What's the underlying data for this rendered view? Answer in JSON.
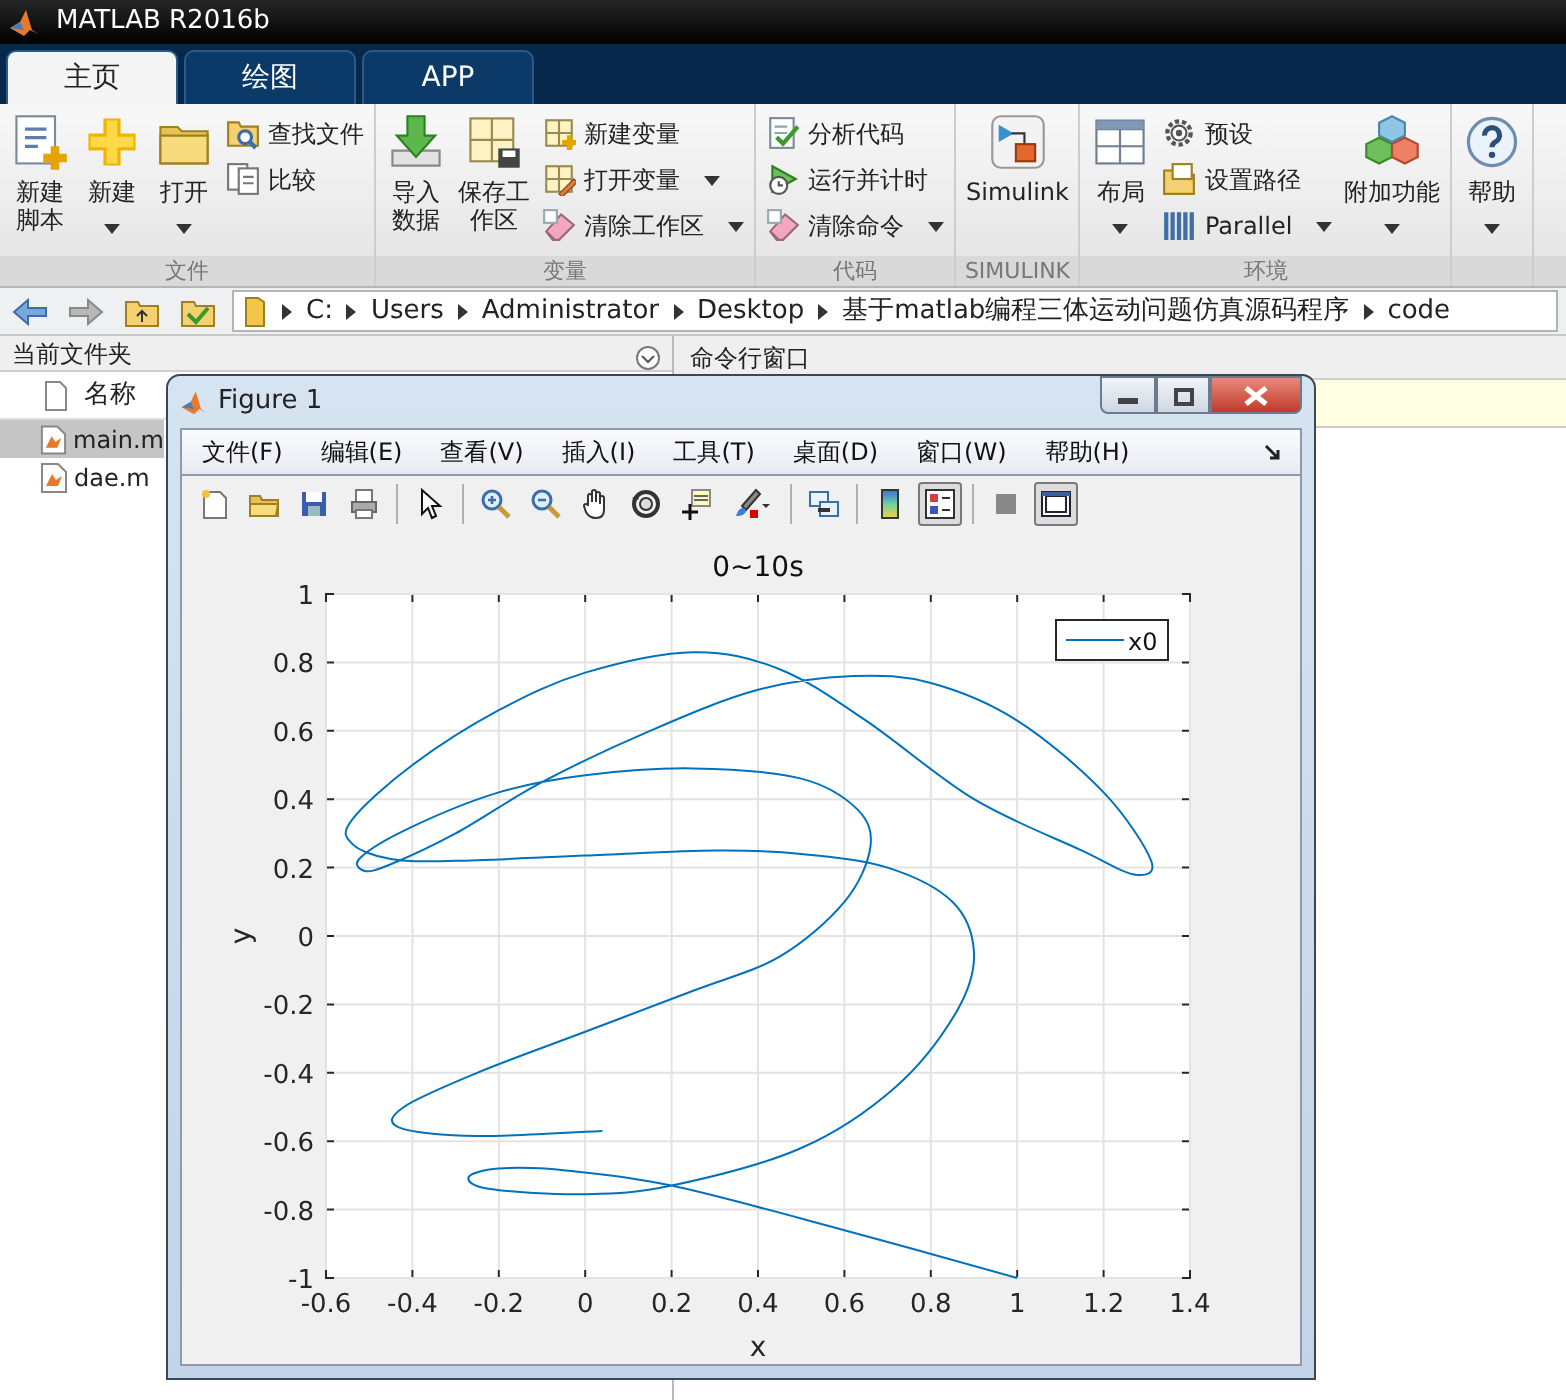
{
  "app_window": {
    "title": "MATLAB R2016b"
  },
  "tabs": [
    {
      "label": "主页",
      "selected": true
    },
    {
      "label": "绘图",
      "selected": false
    },
    {
      "label": "APP",
      "selected": false
    }
  ],
  "ribbon": [
    {
      "label": "文件",
      "columns": [
        {
          "kind": "large",
          "label": "新建脚本",
          "wrapped": true,
          "dropdown": false
        },
        {
          "kind": "large",
          "label": "新建",
          "dropdown": true
        },
        {
          "kind": "large",
          "label": "打开",
          "dropdown": true
        },
        {
          "kind": "stack",
          "items": [
            {
              "label": "查找文件",
              "dropdown": false
            },
            {
              "label": "比较",
              "dropdown": false
            }
          ]
        }
      ]
    },
    {
      "label": "变量",
      "columns": [
        {
          "kind": "large",
          "label": "导入数据",
          "wrapped": true,
          "dropdown": false
        },
        {
          "kind": "large",
          "label": "保存工作区",
          "wrapped": true,
          "dropdown": false
        },
        {
          "kind": "stack",
          "items": [
            {
              "label": "新建变量",
              "dropdown": false
            },
            {
              "label": "打开变量",
              "dropdown": true
            },
            {
              "label": "清除工作区",
              "dropdown": true
            }
          ]
        }
      ]
    },
    {
      "label": "代码",
      "columns": [
        {
          "kind": "stack",
          "items": [
            {
              "label": "分析代码",
              "dropdown": false
            },
            {
              "label": "运行并计时",
              "dropdown": false
            },
            {
              "label": "清除命令",
              "dropdown": true
            }
          ]
        }
      ]
    },
    {
      "label": "SIMULINK",
      "columns": [
        {
          "kind": "large",
          "label": "Simulink",
          "dropdown": false
        }
      ]
    },
    {
      "label": "环境",
      "columns": [
        {
          "kind": "large",
          "label": "布局",
          "dropdown": true
        },
        {
          "kind": "stack",
          "items": [
            {
              "label": "预设",
              "dropdown": false
            },
            {
              "label": "设置路径",
              "dropdown": false
            },
            {
              "label": "Parallel",
              "dropdown": true
            }
          ]
        },
        {
          "kind": "large",
          "label": "附加功能",
          "dropdown": true
        }
      ]
    },
    {
      "columns": [
        {
          "kind": "large",
          "label": "帮助",
          "dropdown": true
        }
      ]
    }
  ],
  "address_bar": {
    "path": [
      "C:",
      "Users",
      "Administrator",
      "Desktop",
      "基于matlab编程三体运动问题仿真源码程序",
      "code"
    ]
  },
  "current_folder": {
    "title": "当前文件夹",
    "column": "名称",
    "files": [
      {
        "name": "main.m",
        "selected": true
      },
      {
        "name": "dae.m",
        "selected": false
      }
    ]
  },
  "command_window": {
    "title": "命令行窗口"
  },
  "figure": {
    "title": "Figure 1",
    "menu": [
      "文件(F)",
      "编辑(E)",
      "查看(V)",
      "插入(I)",
      "工具(T)",
      "桌面(D)",
      "窗口(W)",
      "帮助(H)"
    ],
    "toolbar": [
      [
        {
          "pressed": false
        },
        {
          "pressed": false
        },
        {
          "pressed": false
        },
        {
          "pressed": false
        }
      ],
      [
        {
          "pressed": false
        }
      ],
      [
        {
          "pressed": false
        },
        {
          "pressed": false
        },
        {
          "pressed": false
        },
        {
          "pressed": false
        },
        {
          "pressed": false
        },
        {
          "pressed": false
        }
      ],
      [
        {
          "pressed": false
        }
      ],
      [
        {
          "pressed": false
        },
        {
          "pressed": true
        }
      ],
      [
        {
          "pressed": false
        },
        {
          "pressed": true
        }
      ]
    ],
    "chart_data": {
      "type": "line",
      "grid": true,
      "title": "0~10s",
      "xlabel": "x",
      "ylabel": "y",
      "xlim": [
        -0.6,
        1.4
      ],
      "ylim": [
        -1,
        1
      ],
      "xticks": [
        -0.6,
        -0.4,
        -0.2,
        0,
        0.2,
        0.4,
        0.6,
        0.8,
        1,
        1.2,
        1.4
      ],
      "yticks": [
        -1,
        -0.8,
        -0.6,
        -0.4,
        -0.2,
        0,
        0.2,
        0.4,
        0.6,
        0.8,
        1
      ],
      "x": [
        1.0,
        0.6,
        0.2,
        -0.05,
        -0.2,
        -0.27,
        -0.22,
        0,
        0.2,
        0.5,
        0.72,
        0.86,
        0.9,
        0.85,
        0.7,
        0.5,
        0.3,
        0,
        -0.3,
        -0.45,
        -0.54,
        -0.54,
        -0.4,
        -0.2,
        0,
        0.25,
        0.45,
        0.65,
        0.9,
        1.15,
        1.27,
        1.31,
        1.2,
        1.0,
        0.8,
        0.62,
        0.4,
        0.15,
        -0.1,
        -0.3,
        -0.45,
        -0.51,
        -0.52,
        -0.4,
        -0.2,
        0,
        0.25,
        0.5,
        0.63,
        0.66,
        0.6,
        0.45,
        0.25,
        0,
        -0.25,
        -0.42,
        -0.43,
        -0.25,
        0.04
      ],
      "series": [
        {
          "name": "x0",
          "color": "#0072bd",
          "values": [
            -1.0,
            -0.86,
            -0.73,
            -0.685,
            -0.68,
            -0.705,
            -0.74,
            -0.755,
            -0.73,
            -0.62,
            -0.44,
            -0.22,
            -0.05,
            0.1,
            0.2,
            0.24,
            0.25,
            0.235,
            0.22,
            0.225,
            0.27,
            0.34,
            0.5,
            0.66,
            0.77,
            0.83,
            0.78,
            0.63,
            0.4,
            0.25,
            0.18,
            0.22,
            0.42,
            0.63,
            0.74,
            0.76,
            0.72,
            0.6,
            0.45,
            0.3,
            0.21,
            0.19,
            0.23,
            0.32,
            0.42,
            0.47,
            0.49,
            0.46,
            0.37,
            0.26,
            0.1,
            -0.06,
            -0.16,
            -0.28,
            -0.4,
            -0.5,
            -0.56,
            -0.585,
            -0.57
          ]
        }
      ]
    }
  }
}
